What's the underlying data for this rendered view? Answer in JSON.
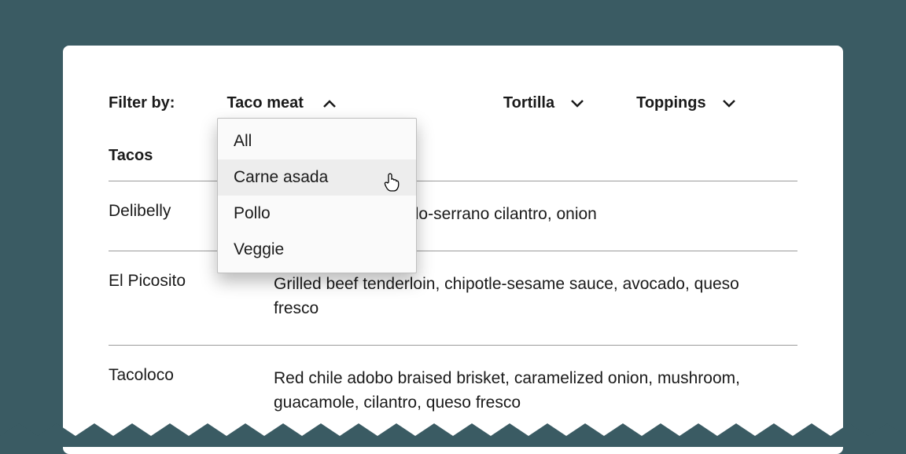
{
  "filters": {
    "prefix": "Filter by:",
    "taco_meat": {
      "label": "Taco meat",
      "open": true
    },
    "tortilla": {
      "label": "Tortilla",
      "open": false
    },
    "toppings": {
      "label": "Toppings",
      "open": false
    },
    "options": [
      {
        "label": "All"
      },
      {
        "label": "Carne asada"
      },
      {
        "label": "Pollo"
      },
      {
        "label": "Veggie"
      }
    ]
  },
  "table": {
    "header": "Tacos",
    "rows": [
      {
        "name": "Delibelly",
        "desc": "Slow Honey tomatillo-serrano cilantro, onion"
      },
      {
        "name": "El Picosito",
        "desc": "Grilled beef tenderloin, chipotle-sesame sauce, avocado, queso fresco"
      },
      {
        "name": "Tacoloco",
        "desc": "Red chile adobo braised brisket, caramelized onion, mushroom, guacamole, cilantro, queso fresco"
      }
    ]
  }
}
